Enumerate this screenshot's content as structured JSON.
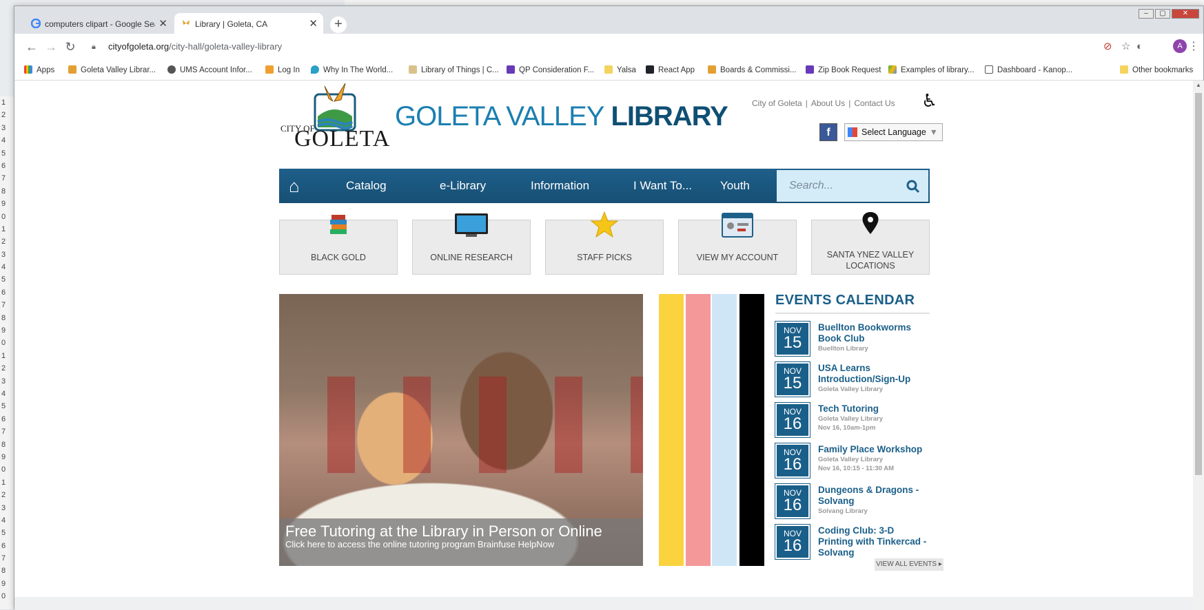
{
  "browser": {
    "tabs": [
      {
        "title": "computers clipart - Google Search"
      },
      {
        "title": "Library | Goleta, CA"
      }
    ],
    "url_host": "cityofgoleta.org",
    "url_path": "/city-hall/goleta-valley-library",
    "profile_initial": "A",
    "bookmarks": [
      "Apps",
      "Goleta Valley Librar...",
      "UMS Account Infor...",
      "Log In",
      "Why In The World...",
      "Library of Things | C...",
      "QP Consideration F...",
      "Yalsa",
      "React App",
      "Boards & Commissi...",
      "Zip Book Request",
      "Examples of library...",
      "Dashboard - Kanop..."
    ],
    "other_bookmarks": "Other bookmarks"
  },
  "site": {
    "logo_city": "CITY OF",
    "logo_name": "GOLETA",
    "title_light": "GOLETA VALLEY",
    "title_bold": "LIBRARY",
    "top_links": [
      "City of Goleta",
      "About Us",
      "Contact Us"
    ],
    "facebook": "f",
    "language": "Select Language",
    "nav": [
      "Catalog",
      "e-Library",
      "Information",
      "I Want To...",
      "Youth"
    ],
    "search_placeholder": "Search...",
    "quick_links": [
      "BLACK GOLD",
      "ONLINE RESEARCH",
      "STAFF PICKS",
      "VIEW MY ACCOUNT",
      "SANTA YNEZ VALLEY LOCATIONS"
    ],
    "slide": {
      "title": "Free Tutoring at the Library in Person or Online",
      "subtitle": "Click here to access the online tutoring program Brainfuse HelpNow"
    },
    "events_title": "EVENTS CALENDAR",
    "events": [
      {
        "month": "NOV",
        "day": "15",
        "name": "Buellton Bookworms Book Club",
        "location": "Buellton Library",
        "time": ""
      },
      {
        "month": "NOV",
        "day": "15",
        "name": "USA Learns Introduction/Sign-Up",
        "location": "Goleta Valley Library",
        "time": ""
      },
      {
        "month": "NOV",
        "day": "16",
        "name": "Tech Tutoring",
        "location": "Goleta Valley Library",
        "time": "Nov 16, 10am-1pm"
      },
      {
        "month": "NOV",
        "day": "16",
        "name": "Family Place Workshop",
        "location": "Goleta Valley Library",
        "time": "Nov 16, 10:15 - 11:30 AM"
      },
      {
        "month": "NOV",
        "day": "16",
        "name": "Dungeons & Dragons - Solvang",
        "location": "Solvang Library",
        "time": ""
      },
      {
        "month": "NOV",
        "day": "16",
        "name": "Coding Club: 3-D Printing with Tinkercad - Solvang",
        "location": "",
        "time": ""
      }
    ],
    "view_all": "VIEW ALL EVENTS ▸"
  }
}
